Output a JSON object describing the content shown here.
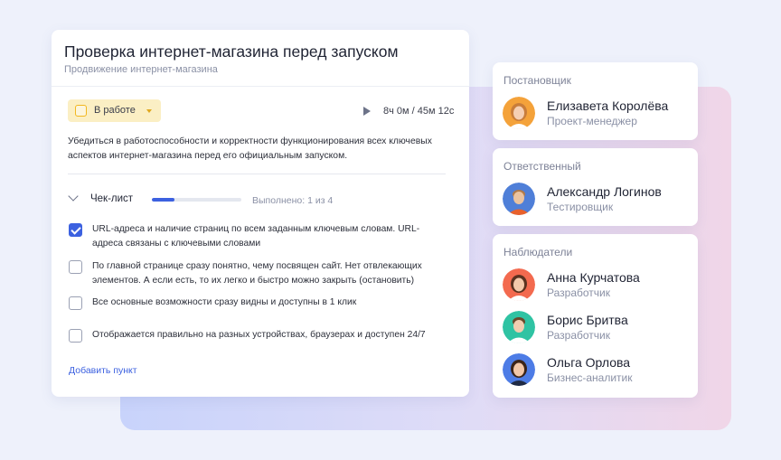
{
  "task": {
    "title": "Проверка интернет-магазина перед запуском",
    "subtitle": "Продвижение интернет-магазина",
    "status": {
      "label": "В работе",
      "color": "#f2b71f"
    },
    "timer": "8ч 0м / 45м 12с",
    "description": "Убедиться в работоспособности и корректности функционирования всех ключевых аспектов интернет-магазина перед его официальным запуском.",
    "checklist": {
      "title": "Чек-лист",
      "progress_fraction": 0.25,
      "done_text": "Выполнено: 1 из 4",
      "items": [
        {
          "text": "URL-адреса и наличие страниц по всем заданным ключевым словам. URL-адреса связаны с ключевыми словами",
          "checked": true
        },
        {
          "text": "По главной странице сразу понятно, чему посвящен сайт. Нет отвлекающих элементов. А если есть, то их легко и быстро можно закрыть (остановить)",
          "checked": false
        },
        {
          "text": "Все основные возможности сразу видны и доступны в 1 клик",
          "checked": false
        },
        {
          "text": "Отображается правильно на разных устройствах, браузерах и доступен 24/7",
          "checked": false
        }
      ],
      "add_label": "Добавить пункт"
    }
  },
  "assigner": {
    "heading": "Постановщик",
    "person": {
      "name": "Елизавета Королёва",
      "role": "Проект-менеджер",
      "avatar_bg": "#f4a23a"
    }
  },
  "responsible": {
    "heading": "Ответственный",
    "person": {
      "name": "Александр Логинов",
      "role": "Тестировщик",
      "avatar_bg": "#4f7fd8"
    }
  },
  "observers": {
    "heading": "Наблюдатели",
    "people": [
      {
        "name": "Анна Курчатова",
        "role": "Разработчик",
        "avatar_bg": "#f36a4f"
      },
      {
        "name": "Борис Бритва",
        "role": "Разработчик",
        "avatar_bg": "#2fc3a3"
      },
      {
        "name": "Ольга Орлова",
        "role": "Бизнес-аналитик",
        "avatar_bg": "#4d7ce6"
      }
    ]
  },
  "colors": {
    "accent": "#3c61e0",
    "status_bg": "#fbefc4"
  }
}
